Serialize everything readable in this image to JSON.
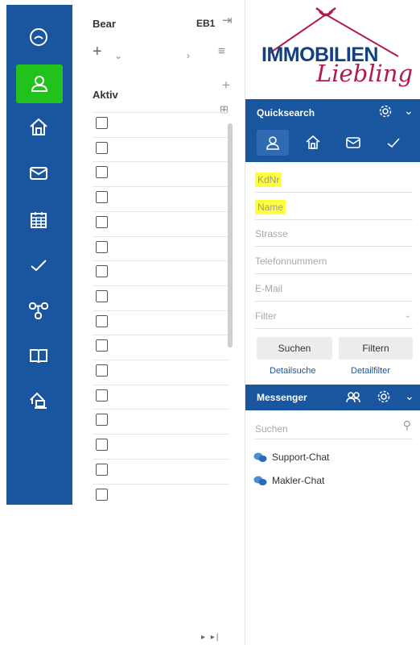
{
  "rail": {
    "items": [
      {
        "icon": "speedometer-icon",
        "active": false
      },
      {
        "icon": "person-icon",
        "active": true
      },
      {
        "icon": "home-icon",
        "active": false
      },
      {
        "icon": "mail-icon",
        "active": false
      },
      {
        "icon": "calendar-icon",
        "active": false
      },
      {
        "icon": "check-icon",
        "active": false
      },
      {
        "icon": "network-icon",
        "active": false
      },
      {
        "icon": "book-icon",
        "active": false
      },
      {
        "icon": "house-laptop-icon",
        "active": false
      }
    ]
  },
  "list": {
    "title": "Bear",
    "tab_text": "EB1",
    "column_header": "Aktiv",
    "row_count": 16
  },
  "logo": {
    "main": "IMMOBILIEN",
    "sub": "Liebling"
  },
  "quicksearch": {
    "title": "Quicksearch",
    "fields": [
      {
        "placeholder": "KdNr",
        "highlight": true
      },
      {
        "placeholder": "Name",
        "highlight": true
      },
      {
        "placeholder": "Strasse",
        "highlight": false
      },
      {
        "placeholder": "Telefonnummern",
        "highlight": false
      },
      {
        "placeholder": "E-Mail",
        "highlight": false
      },
      {
        "placeholder": "Filter",
        "highlight": false,
        "dropdown": true
      }
    ],
    "search_button": "Suchen",
    "filter_button": "Filtern",
    "detail_search_link": "Detailsuche",
    "detail_filter_link": "Detailfilter"
  },
  "messenger": {
    "title": "Messenger",
    "search_placeholder": "Suchen",
    "chats": [
      "Support-Chat",
      "Makler-Chat"
    ]
  },
  "colors": {
    "brand_blue": "#1a56a0",
    "active_green": "#22c21c",
    "highlight_yellow": "#ffff3d",
    "logo_red": "#b01a4f"
  }
}
